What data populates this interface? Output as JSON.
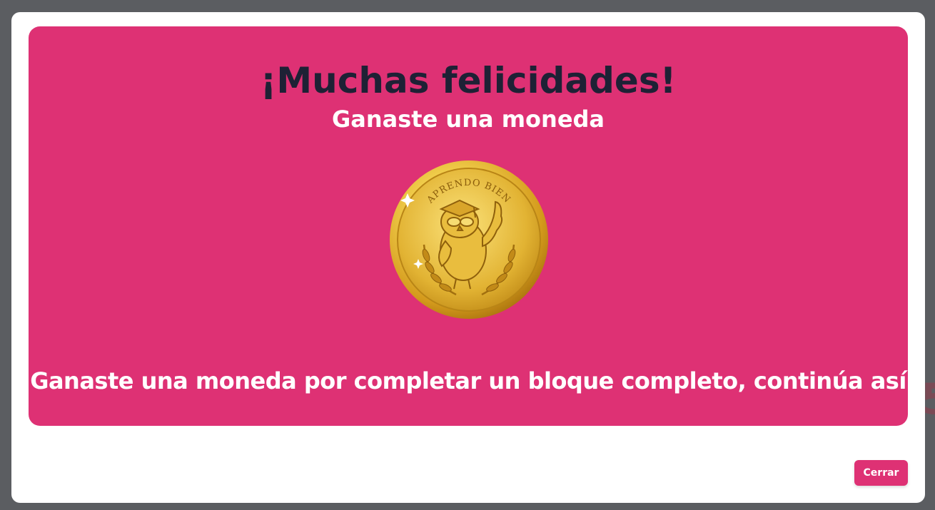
{
  "modal": {
    "title": "¡Muchas felicidades!",
    "subtitle": "Ganaste una moneda",
    "coin": {
      "icon": "owl-coin-icon",
      "inscription": "APRENDO BIEN"
    },
    "message": "Ganaste una moneda por completar un bloque completo, continúa así",
    "close_label": "Cerrar"
  },
  "colors": {
    "backdrop": "#5b5d61",
    "banner": "#de3174",
    "title_text": "#1e2135",
    "button": "#de3174",
    "coin_gold": "#e3b532"
  }
}
